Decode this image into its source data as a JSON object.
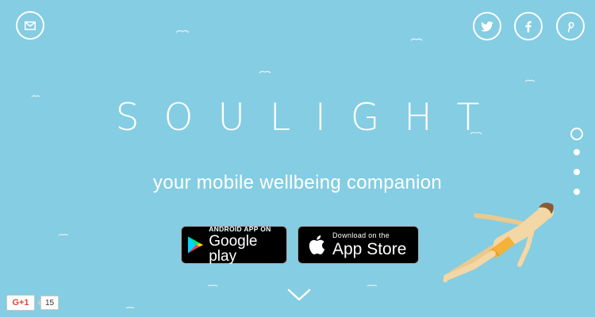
{
  "colors": {
    "background": "#85cde2",
    "accent": "#ffffff",
    "swimsuit": "#f4b23a",
    "skin": "#f3d7a4"
  },
  "hero": {
    "brand": "SOULIGHT",
    "tagline": "your mobile wellbeing companion"
  },
  "header": {
    "icons": [
      "mail-icon",
      "twitter-icon",
      "facebook-icon",
      "pinterest-icon"
    ]
  },
  "stores": {
    "google_play": {
      "small": "ANDROID APP ON",
      "big": "Google play"
    },
    "app_store": {
      "small": "Download on the",
      "big": "App Store"
    }
  },
  "pager": {
    "count": 4,
    "active_index": 0
  },
  "gplus": {
    "label": "G+1",
    "count": "15"
  }
}
